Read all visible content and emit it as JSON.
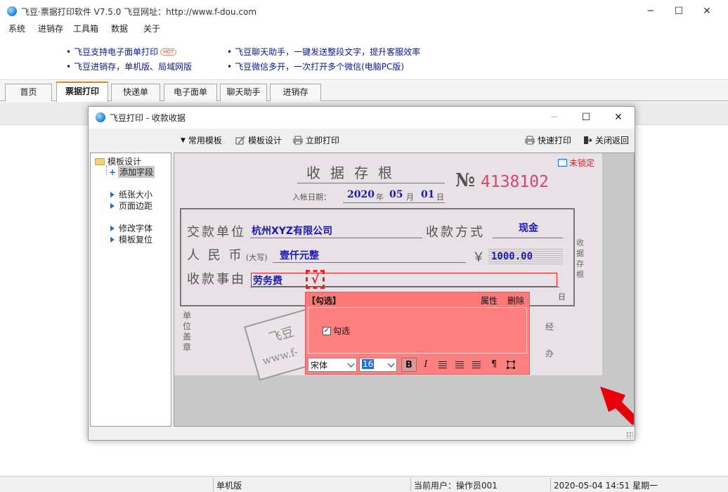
{
  "app": {
    "title": "飞豆·票据打印软件 V7.5.0   飞豆网址：http://www.f-dou.com",
    "window_controls": {
      "minimize": "─",
      "maximize": "☐",
      "close": "✕"
    }
  },
  "menu": [
    "系统",
    "进销存",
    "工具箱",
    "数据",
    "关于"
  ],
  "ads": {
    "left": [
      "飞豆支持电子面单打印",
      "飞豆进销存，单机版、局域网版"
    ],
    "hot_badge": "HOT",
    "right": [
      "飞豆聊天助手，一键发送整段文字，提升客服效率",
      "飞豆微信多开，一次打开多个微信(电脑PC版)"
    ]
  },
  "tabs": [
    {
      "label": "首页",
      "active": false
    },
    {
      "label": "票据打印",
      "active": true
    },
    {
      "label": "快递单",
      "active": false
    },
    {
      "label": "电子面单",
      "active": false
    },
    {
      "label": "聊天助手",
      "active": false
    },
    {
      "label": "进销存",
      "active": false
    }
  ],
  "dialog": {
    "title": "飞豆打印 - 收款收据",
    "controls": {
      "minimize": "─",
      "maximize": "☐",
      "close": "✕"
    },
    "toolbar": {
      "templates": "常用模板",
      "design": "模板设计",
      "print_now": "立即打印",
      "quick_print": "快速打印",
      "close_return": "关闭返回"
    },
    "sidebar": {
      "root": "模板设计",
      "add_field": "添加字段",
      "items": [
        "纸张大小",
        "页面边距",
        "修改字体",
        "模板复位"
      ]
    },
    "receipt": {
      "title": "收据存根",
      "date_label": "入帐日期：",
      "year": "2020",
      "year_unit": "年",
      "month": "05",
      "month_unit": "月",
      "day": "01",
      "day_unit": "日",
      "no_label": "№",
      "no_value": "4138102",
      "unlocked": "未锁定",
      "payer_label": "交款单位",
      "payer_value": "杭州XYZ有限公司",
      "method_label": "收款方式",
      "method_value": "现金",
      "rmb_label": "人 民 币",
      "rmb_small": "(大写)",
      "rmb_value": "壹仟元整",
      "yen": "￥",
      "amount": "1000.00",
      "reason_label": "收款事由",
      "reason_value": "劳务费",
      "check_mark": "√",
      "tail_date": "日",
      "side_vertical": "收据存根",
      "unit_seal": "单位盖章",
      "handler": "经办",
      "stamp_text_1": "飞豆",
      "stamp_text_2": "www.f-"
    },
    "field_popup": {
      "title": "【勾选】",
      "properties": "属性",
      "delete": "删除",
      "check_label": "勾选",
      "checked": true,
      "check_glyph": "✓",
      "font": "宋体",
      "size": "16",
      "bold": "B",
      "italic": "I",
      "para": "¶"
    }
  },
  "status": {
    "edition": "单机版",
    "user": "当前用户：操作员001",
    "datetime": "2020-05-04 14:51 星期一"
  },
  "colors": {
    "accent_tab": "#e38a1c",
    "receipt_blue": "#1a1ab3",
    "number_red": "#d4476a",
    "popup": "#ff8080",
    "arrow": "#e8000a"
  }
}
